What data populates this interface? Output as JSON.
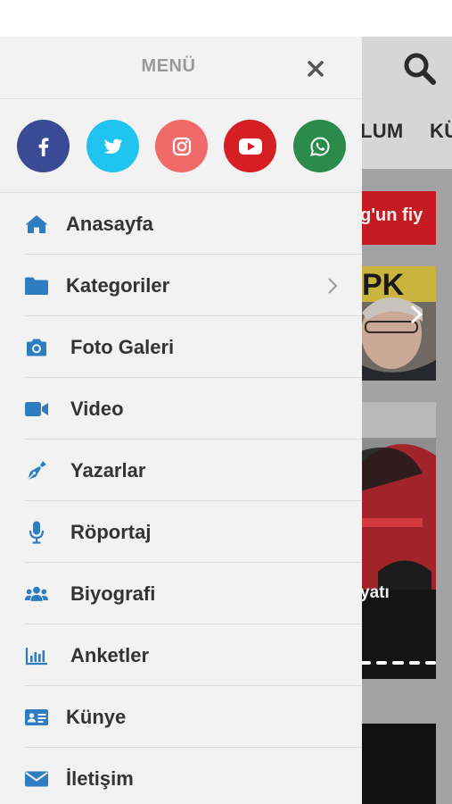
{
  "background": {
    "nav_items": [
      "LUM",
      "KÜ"
    ],
    "headline_fragment": "g'un fiy",
    "photo_caption_fragment": "yatı"
  },
  "menu": {
    "title": "MENÜ",
    "close_icon": "close-icon",
    "social": [
      {
        "name": "facebook",
        "icon": "facebook-icon",
        "color": "#3b4a94"
      },
      {
        "name": "twitter",
        "icon": "twitter-icon",
        "color": "#1fc5f0"
      },
      {
        "name": "instagram",
        "icon": "instagram-icon",
        "color": "#f06a6a"
      },
      {
        "name": "youtube",
        "icon": "youtube-icon",
        "color": "#d51f24"
      },
      {
        "name": "whatsapp",
        "icon": "whatsapp-icon",
        "color": "#2a8b4a"
      }
    ],
    "items": [
      {
        "label": "Anasayfa",
        "icon": "home-icon"
      },
      {
        "label": "Kategoriler",
        "icon": "folder-icon",
        "has_submenu": true
      },
      {
        "label": "Foto Galeri",
        "icon": "camera-icon"
      },
      {
        "label": "Video",
        "icon": "video-camera-icon"
      },
      {
        "label": "Yazarlar",
        "icon": "pen-icon"
      },
      {
        "label": "Röportaj",
        "icon": "microphone-icon"
      },
      {
        "label": "Biyografi",
        "icon": "users-icon"
      },
      {
        "label": "Anketler",
        "icon": "bar-chart-icon"
      },
      {
        "label": "Künye",
        "icon": "id-card-icon"
      },
      {
        "label": "İletişim",
        "icon": "envelope-icon"
      }
    ]
  },
  "colors": {
    "accent_icon": "#2f7dc1",
    "label_text": "#333333",
    "menu_title": "#9a9a9a",
    "drawer_bg": "#f2f2f2",
    "overlay_bg": "#a3a3a3",
    "headline_red": "#c61b22"
  }
}
